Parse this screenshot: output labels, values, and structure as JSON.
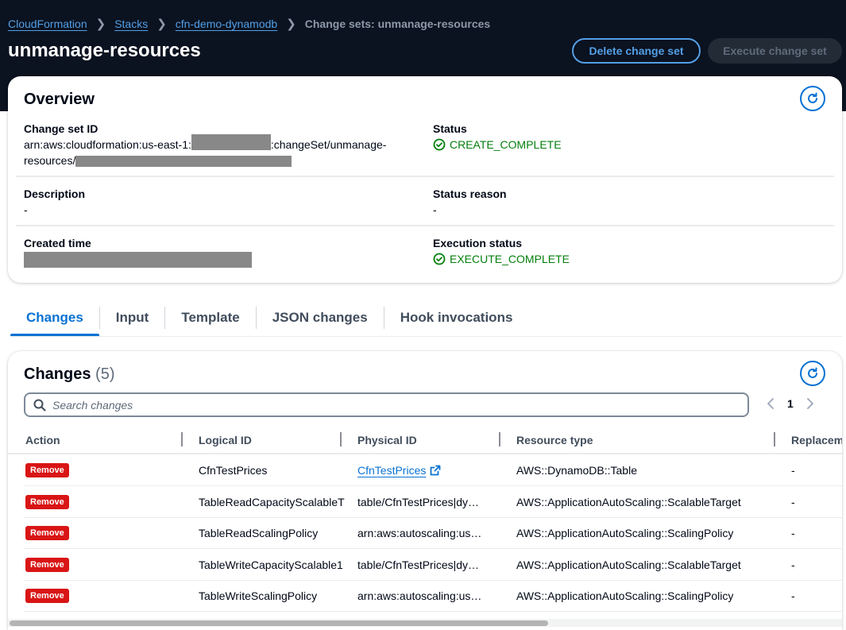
{
  "breadcrumb": [
    {
      "label": "CloudFormation",
      "link": true
    },
    {
      "label": "Stacks",
      "link": true
    },
    {
      "label": "cfn-demo-dynamodb",
      "link": true
    },
    {
      "label": "Change sets: unmanage-resources",
      "link": false
    }
  ],
  "header": {
    "title": "unmanage-resources",
    "delete_label": "Delete change set",
    "execute_label": "Execute change set"
  },
  "overview": {
    "title": "Overview",
    "change_set_id_label": "Change set ID",
    "change_set_id_prefix": "arn:aws:cloudformation:us-east-1:",
    "change_set_id_mid": ":changeSet/unmanage-",
    "change_set_id_line2": "resources/",
    "status_label": "Status",
    "status_value": "CREATE_COMPLETE",
    "description_label": "Description",
    "description_value": "-",
    "status_reason_label": "Status reason",
    "status_reason_value": "-",
    "created_time_label": "Created time",
    "execution_status_label": "Execution status",
    "execution_status_value": "EXECUTE_COMPLETE"
  },
  "tabs": [
    {
      "label": "Changes",
      "active": true
    },
    {
      "label": "Input",
      "active": false
    },
    {
      "label": "Template",
      "active": false
    },
    {
      "label": "JSON changes",
      "active": false
    },
    {
      "label": "Hook invocations",
      "active": false
    }
  ],
  "changes": {
    "title": "Changes",
    "count": "(5)",
    "search_placeholder": "Search changes",
    "search_value": "",
    "page": "1",
    "columns": [
      "Action",
      "Logical ID",
      "Physical ID",
      "Resource type",
      "Replacem"
    ],
    "rows": [
      {
        "action": "Remove",
        "logical_id": "CfnTestPrices",
        "physical_id": "CfnTestPrices",
        "physical_link": true,
        "resource_type": "AWS::DynamoDB::Table",
        "replacement": "-"
      },
      {
        "action": "Remove",
        "logical_id": "TableReadCapacityScalableT",
        "physical_id": "table/CfnTestPrices|dy…",
        "physical_link": false,
        "resource_type": "AWS::ApplicationAutoScaling::ScalableTarget",
        "replacement": "-"
      },
      {
        "action": "Remove",
        "logical_id": "TableReadScalingPolicy",
        "physical_id": "arn:aws:autoscaling:us…",
        "physical_link": false,
        "resource_type": "AWS::ApplicationAutoScaling::ScalingPolicy",
        "replacement": "-"
      },
      {
        "action": "Remove",
        "logical_id": "TableWriteCapacityScalable1",
        "physical_id": "table/CfnTestPrices|dy…",
        "physical_link": false,
        "resource_type": "AWS::ApplicationAutoScaling::ScalableTarget",
        "replacement": "-"
      },
      {
        "action": "Remove",
        "logical_id": "TableWriteScalingPolicy",
        "physical_id": "arn:aws:autoscaling:us…",
        "physical_link": false,
        "resource_type": "AWS::ApplicationAutoScaling::ScalingPolicy",
        "replacement": "-"
      }
    ]
  },
  "colors": {
    "header_bg": "#0b1220",
    "link_dark": "#539fe5",
    "primary": "#0972d3",
    "success": "#037f0c",
    "danger": "#d91515"
  }
}
